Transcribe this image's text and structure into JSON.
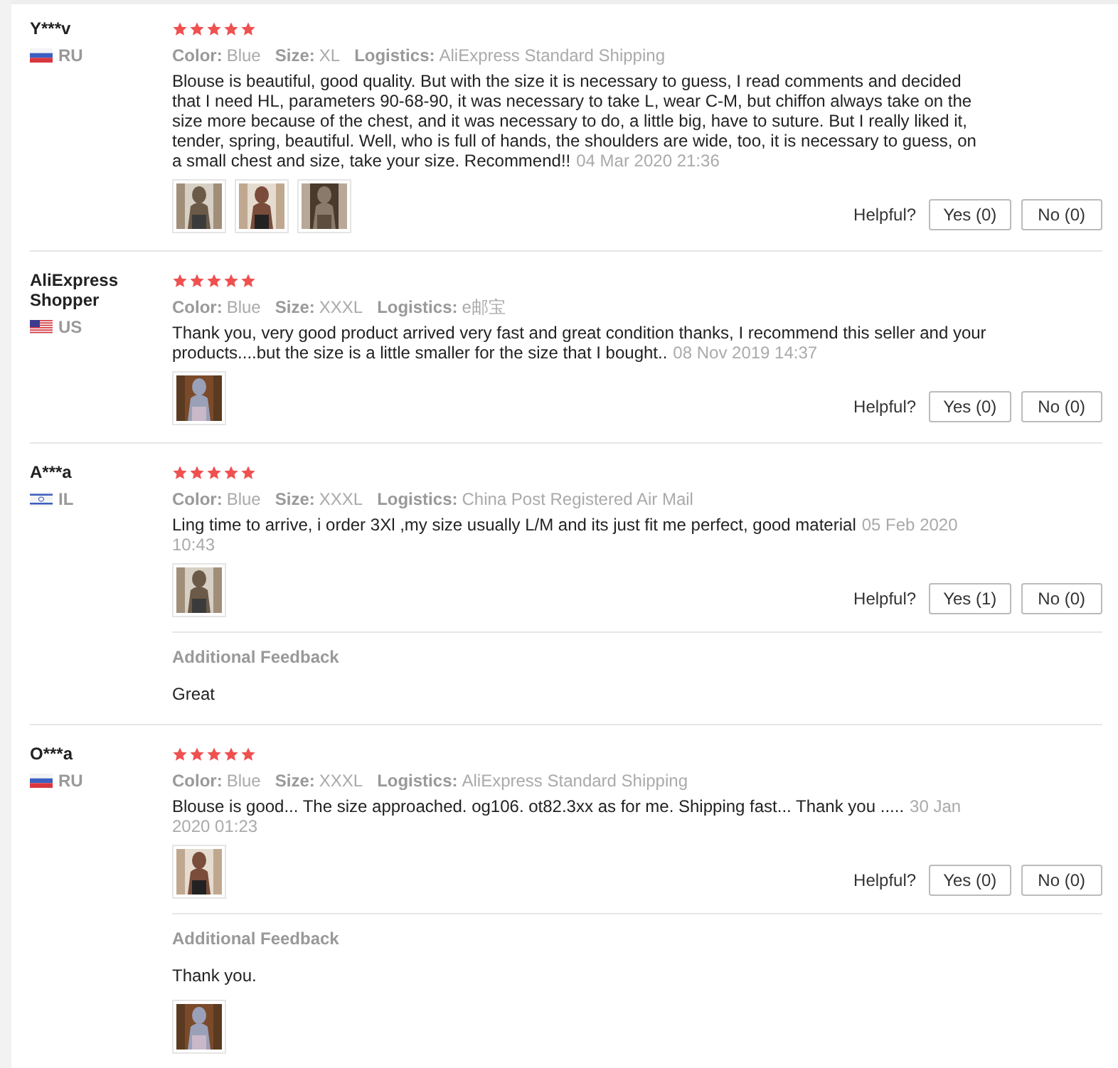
{
  "reviews": [
    {
      "name": "Y***v",
      "country": "RU",
      "flag": {
        "kind": "ru"
      },
      "stars": 5,
      "attributes": [
        {
          "label": "Color:",
          "value": "Blue"
        },
        {
          "label": "Size:",
          "value": "XL"
        },
        {
          "label": "Logistics:",
          "value": "AliExpress Standard Shipping"
        }
      ],
      "text": "Blouse is beautiful, good quality. But with the size it is necessary to guess, I read comments and decided that I need HL, parameters 90-68-90, it was necessary to take L, wear C-M, but chiffon always take on the size more because of the chest, and it was necessary to do, a little big, have to suture. But I really liked it, tender, spring, beautiful. Well, who is full of hands, the shoulders are wide, too, it is necessary to guess, on a small chest and size, take your size. Recommend!!",
      "date": "04 Mar 2020 21:36",
      "photos": [
        {
          "kind": "picture"
        },
        {
          "kind": "picture"
        },
        {
          "kind": "picture"
        }
      ],
      "helpful_label": "Helpful?",
      "yes": "Yes (0)",
      "no": "No (0)"
    },
    {
      "name": "AliExpress Shopper",
      "country": "US",
      "flag": {
        "kind": "us"
      },
      "stars": 5,
      "attributes": [
        {
          "label": "Color:",
          "value": "Blue"
        },
        {
          "label": "Size:",
          "value": "XXXL"
        },
        {
          "label": "Logistics:",
          "value": "e邮宝"
        }
      ],
      "text": "Thank you, very good product arrived very fast and great condition thanks, I recommend this seller and your products....but the size is a little smaller for the size that I bought..",
      "date": "08 Nov 2019 14:37",
      "photos": [
        {
          "kind": "picture"
        }
      ],
      "helpful_label": "Helpful?",
      "yes": "Yes (0)",
      "no": "No (0)"
    },
    {
      "name": "A***a",
      "country": "IL",
      "flag": {
        "kind": "il"
      },
      "stars": 5,
      "attributes": [
        {
          "label": "Color:",
          "value": "Blue"
        },
        {
          "label": "Size:",
          "value": "XXXL"
        },
        {
          "label": "Logistics:",
          "value": "China Post Registered Air Mail"
        }
      ],
      "text": "Ling time to arrive, i order 3Xl ,my size usually L/M and its just fit me perfect, good material",
      "date": "05 Feb 2020 10:43",
      "photos": [
        {
          "kind": "picture"
        }
      ],
      "helpful_label": "Helpful?",
      "yes": "Yes (1)",
      "no": "No (0)",
      "additional": {
        "title": "Additional Feedback",
        "text": "Great"
      }
    },
    {
      "name": "O***a",
      "country": "RU",
      "flag": {
        "kind": "ru"
      },
      "stars": 5,
      "attributes": [
        {
          "label": "Color:",
          "value": "Blue"
        },
        {
          "label": "Size:",
          "value": "XXXL"
        },
        {
          "label": "Logistics:",
          "value": "AliExpress Standard Shipping"
        }
      ],
      "text": "Blouse is good... The size approached. og106. ot82.3xx as for me. Shipping fast... Thank you .....",
      "date": "30 Jan 2020 01:23",
      "photos": [
        {
          "kind": "picture"
        }
      ],
      "helpful_label": "Helpful?",
      "yes": "Yes (0)",
      "no": "No (0)",
      "additional": {
        "title": "Additional Feedback",
        "text": "Thank you.",
        "photos": [
          {
            "kind": "picture"
          }
        ]
      }
    }
  ]
}
